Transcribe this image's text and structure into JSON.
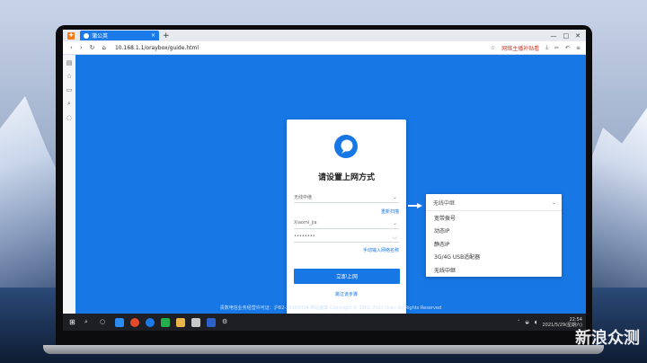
{
  "browser": {
    "tab_title": "蒲公英",
    "tab_close": "×",
    "new_tab": "+",
    "address": "10.168.1.1/oraybox/guide.html",
    "hot_label": "网络主播补贴看",
    "window_controls": [
      "—",
      "□",
      "✕"
    ]
  },
  "card": {
    "title": "请设置上网方式",
    "mode_select": "无线中继",
    "rescan_link": "重新扫描",
    "ssid_select": "Xiaomi_jia",
    "password": "••••••••",
    "manual_link": "手动输入网络名称",
    "submit": "立即上网",
    "skip": "跳过该步骤"
  },
  "dropdown": {
    "selected": "无线中继",
    "options": [
      "宽带拨号",
      "动态IP",
      "静态IP",
      "3G/4G USB适配器",
      "无线中继"
    ]
  },
  "footer": {
    "text": "贵数电信业务经营许可证：沪B2-20100004 网站备案   Copyright © 2002-2021 Oray. All Rights Reserved"
  },
  "taskbar": {
    "time": "22:54",
    "date": "2021/5/29(星期六)"
  },
  "watermark": "新浪众测",
  "colors": {
    "accent": "#1677e5"
  }
}
